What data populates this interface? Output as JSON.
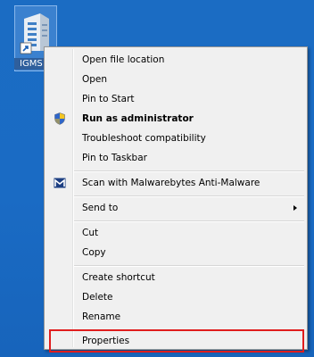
{
  "desktop": {
    "icon": {
      "label": "IGMS",
      "icon_name": "app-shortcut-icon"
    }
  },
  "context_menu": {
    "items": [
      {
        "label": "Open file location"
      },
      {
        "label": "Open"
      },
      {
        "label": "Pin to Start"
      },
      {
        "label": "Run as administrator",
        "icon": "uac-shield-icon",
        "bold": true
      },
      {
        "label": "Troubleshoot compatibility"
      },
      {
        "label": "Pin to Taskbar"
      },
      {
        "label": "Scan with Malwarebytes Anti-Malware",
        "icon": "malwarebytes-icon"
      },
      {
        "label": "Send to",
        "submenu": true
      },
      {
        "label": "Cut"
      },
      {
        "label": "Copy"
      },
      {
        "label": "Create shortcut"
      },
      {
        "label": "Delete"
      },
      {
        "label": "Rename"
      },
      {
        "label": "Properties",
        "highlighted": true
      }
    ]
  },
  "colors": {
    "desktop_background": "#1a6bc4",
    "menu_background": "#f0f0f0",
    "highlight_border": "#e01d1d"
  }
}
